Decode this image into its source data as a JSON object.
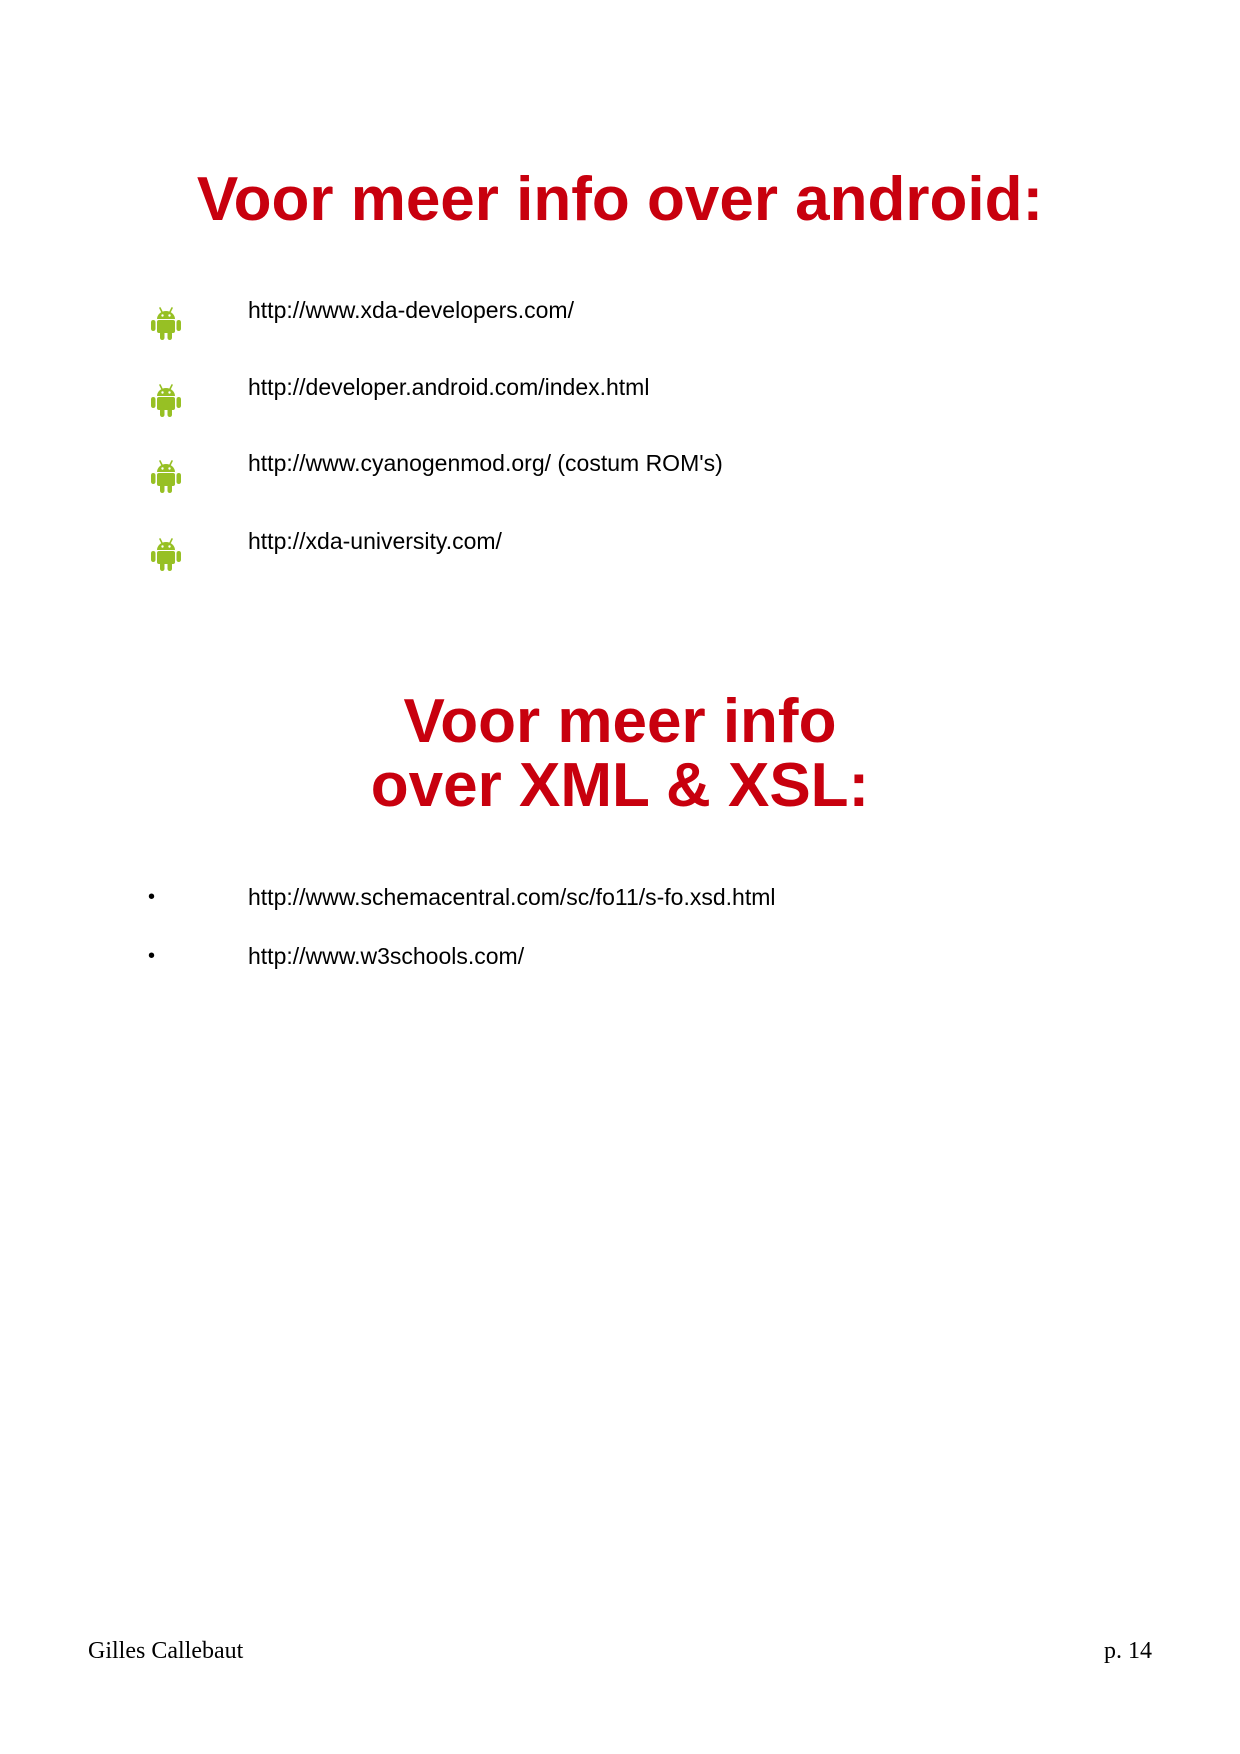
{
  "colors": {
    "heading": "#c8000e",
    "android_icon": "#97c024",
    "text": "#000000"
  },
  "section_android": {
    "heading": "Voor meer info over android:",
    "bullet_icon": "android-robot-icon",
    "links": [
      "http://www.xda-developers.com/",
      "http://developer.android.com/index.html",
      "http://www.cyanogenmod.org/ (costum ROM's)",
      "http://xda-university.com/"
    ]
  },
  "section_xml": {
    "heading_line1": "Voor meer info",
    "heading_line2": "over XML & XSL:",
    "bullet": "•",
    "links": [
      "http://www.schemacentral.com/sc/fo11/s-fo.xsd.html",
      "http://www.w3schools.com/"
    ]
  },
  "footer": {
    "author": "Gilles Callebaut",
    "page": "p. 14"
  }
}
